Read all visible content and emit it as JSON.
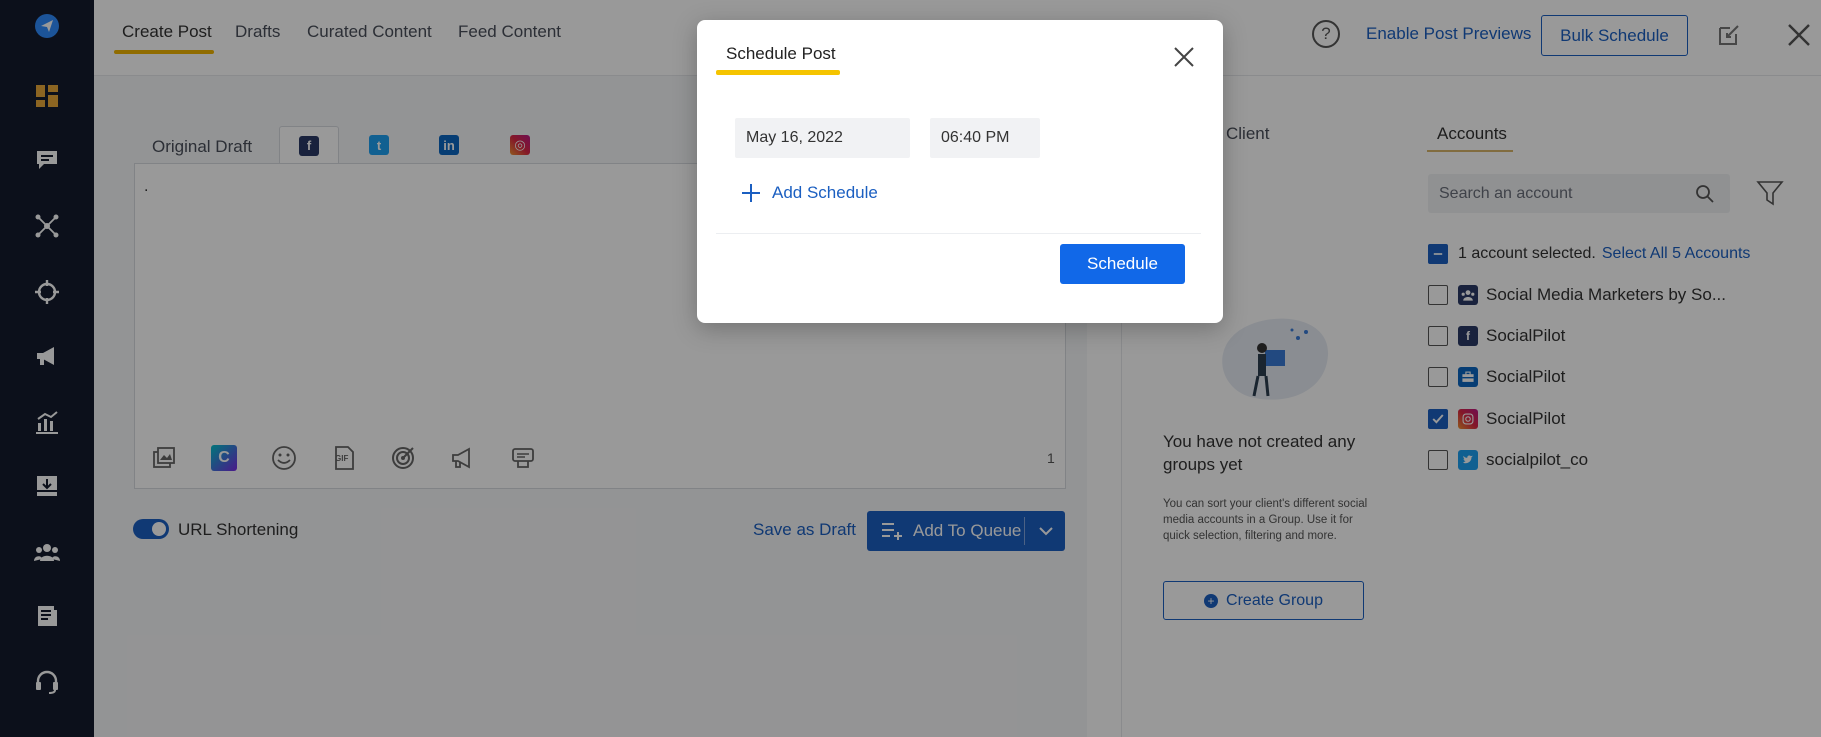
{
  "colors": {
    "sidebar_bg": "#141b2d",
    "accent": "#1b5fc1",
    "primary_button": "#1168e8",
    "tab_highlight": "#f0b400",
    "facebook": "#3b5998",
    "twitter": "#1da1f2",
    "linkedin": "#0a66c2",
    "instagram": "#e1306c"
  },
  "sidebar": {
    "items": [
      {
        "icon": "send-logo-icon"
      },
      {
        "icon": "dashboard-icon"
      },
      {
        "icon": "chat-icon"
      },
      {
        "icon": "network-icon"
      },
      {
        "icon": "target-icon"
      },
      {
        "icon": "megaphone-icon"
      },
      {
        "icon": "analytics-icon"
      },
      {
        "icon": "inbox-icon"
      },
      {
        "icon": "team-icon"
      },
      {
        "icon": "content-library-icon"
      },
      {
        "icon": "support-icon"
      }
    ]
  },
  "topbar": {
    "tabs": [
      {
        "label": "Create Post",
        "active": true
      },
      {
        "label": "Drafts"
      },
      {
        "label": "Curated Content"
      },
      {
        "label": "Feed Content"
      }
    ],
    "help": "?",
    "enable_previews": "Enable Post Previews",
    "bulk_schedule": "Bulk Schedule"
  },
  "editor": {
    "original_draft_tab": "Original Draft",
    "social_tabs": [
      {
        "icon": "facebook-icon",
        "glyph": "f",
        "active": true
      },
      {
        "icon": "twitter-icon",
        "glyph": "t"
      },
      {
        "icon": "linkedin-icon",
        "glyph": "in"
      },
      {
        "icon": "instagram-icon",
        "glyph": "◎"
      }
    ],
    "content": ".",
    "char_count": "1",
    "toolbar": [
      "media-icon",
      "canva-icon",
      "emoji-icon",
      "gif-icon",
      "target-audience-icon",
      "promote-icon",
      "signature-icon"
    ],
    "canva_letter": "C",
    "gif_label": "GIF",
    "url_shortening": "URL Shortening",
    "save_as_draft": "Save as Draft",
    "add_to_queue": "Add To Queue"
  },
  "groups": {
    "client_tab": "Client",
    "empty_title": "You have not created any groups yet",
    "empty_desc": "You can sort your client's different social media accounts in a Group. Use it for quick selection, filtering and more.",
    "create_group": "Create Group"
  },
  "accounts": {
    "tab": "Accounts",
    "search_placeholder": "Search an account",
    "selected_text": "1 account selected.",
    "select_all": "Select All 5 Accounts",
    "items": [
      {
        "name": "Social Media Marketers by So...",
        "network": "facebook-group",
        "checked": false
      },
      {
        "name": "SocialPilot",
        "network": "facebook",
        "checked": false
      },
      {
        "name": "SocialPilot",
        "network": "linkedin-page",
        "checked": false
      },
      {
        "name": "SocialPilot",
        "network": "instagram",
        "checked": true
      },
      {
        "name": "socialpilot_co",
        "network": "twitter",
        "checked": false
      }
    ]
  },
  "modal": {
    "title": "Schedule Post",
    "date": "May 16, 2022",
    "time": "06:40 PM",
    "add_schedule": "Add Schedule",
    "schedule_button": "Schedule"
  }
}
